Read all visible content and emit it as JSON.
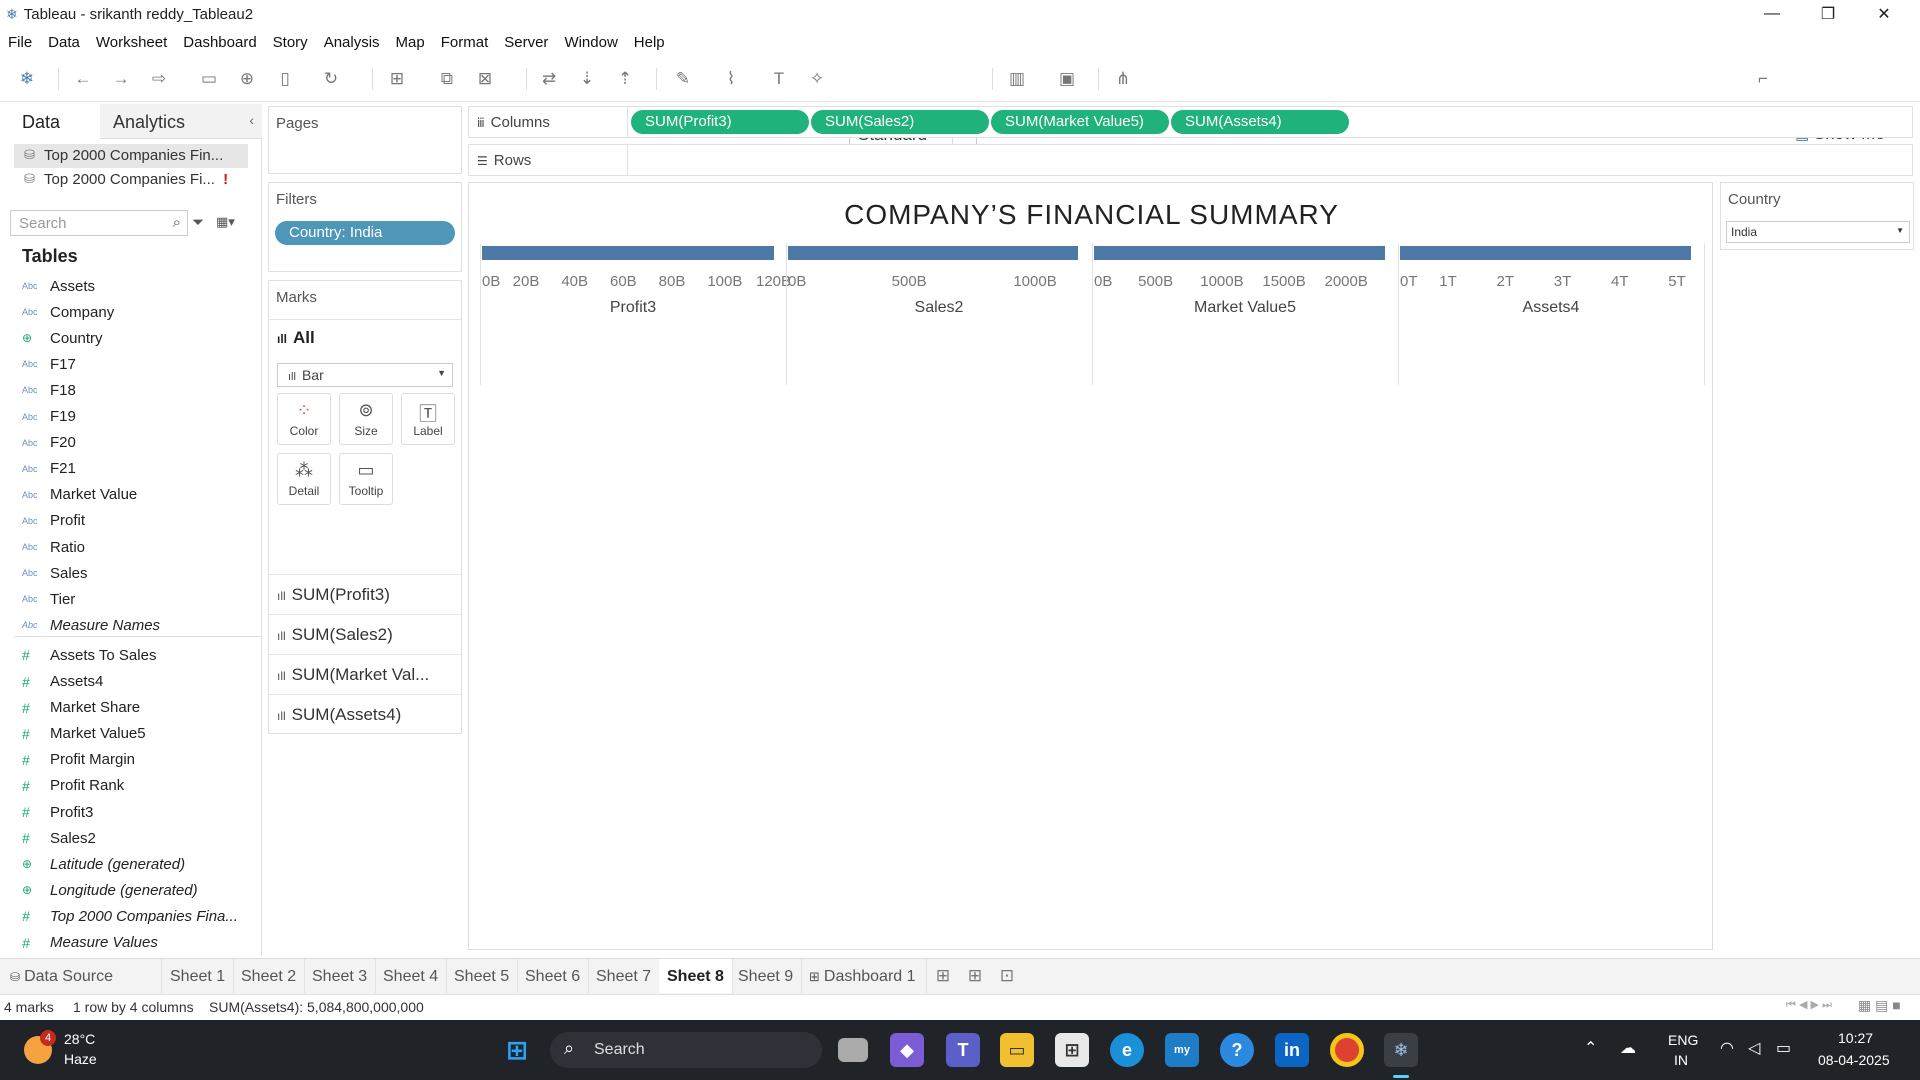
{
  "window": {
    "title": "Tableau - srikanth reddy_Tableau2"
  },
  "menu": [
    "File",
    "Data",
    "Worksheet",
    "Dashboard",
    "Story",
    "Analysis",
    "Map",
    "Format",
    "Server",
    "Window",
    "Help"
  ],
  "toolbar": {
    "fit": "Standard",
    "show_me": "Show Me"
  },
  "data_pane": {
    "tab_data": "Data",
    "tab_analytics": "Analytics",
    "sources": [
      "Top 2000 Companies Fin...",
      "Top 2000 Companies Fi..."
    ],
    "source_warning": "!",
    "search_placeholder": "Search",
    "tables_label": "Tables",
    "dimensions": [
      {
        "name": "Assets",
        "type": "Abc"
      },
      {
        "name": "Company",
        "type": "Abc"
      },
      {
        "name": "Country",
        "type": "geo"
      },
      {
        "name": "F17",
        "type": "Abc"
      },
      {
        "name": "F18",
        "type": "Abc"
      },
      {
        "name": "F19",
        "type": "Abc"
      },
      {
        "name": "F20",
        "type": "Abc"
      },
      {
        "name": "F21",
        "type": "Abc"
      },
      {
        "name": "Market Value",
        "type": "Abc"
      },
      {
        "name": "Profit",
        "type": "Abc"
      },
      {
        "name": "Ratio",
        "type": "Abc"
      },
      {
        "name": "Sales",
        "type": "Abc"
      },
      {
        "name": "Tier",
        "type": "Abc"
      },
      {
        "name": "Measure Names",
        "type": "Abc"
      }
    ],
    "measures": [
      {
        "name": "Assets To Sales",
        "type": "#"
      },
      {
        "name": "Assets4",
        "type": "#"
      },
      {
        "name": "Market Share",
        "type": "#"
      },
      {
        "name": "Market Value5",
        "type": "#"
      },
      {
        "name": "Profit Margin",
        "type": "#"
      },
      {
        "name": "Profit Rank",
        "type": "#"
      },
      {
        "name": "Profit3",
        "type": "#"
      },
      {
        "name": "Sales2",
        "type": "#"
      },
      {
        "name": "Latitude (generated)",
        "type": "geo"
      },
      {
        "name": "Longitude (generated)",
        "type": "geo"
      },
      {
        "name": "Top 2000 Companies Fina...",
        "type": "#"
      },
      {
        "name": "Measure Values",
        "type": "#"
      }
    ]
  },
  "shelves": {
    "pages": "Pages",
    "filters": "Filters",
    "filter_pill": "Country: India",
    "marks": "Marks",
    "marks_all": "All",
    "mark_type": "Bar",
    "mark_buttons": [
      "Color",
      "Size",
      "Label",
      "Detail",
      "Tooltip"
    ],
    "mark_measures": [
      "SUM(Profit3)",
      "SUM(Sales2)",
      "SUM(Market Val...",
      "SUM(Assets4)"
    ],
    "columns": "Columns",
    "rows": "Rows",
    "column_pills": [
      "SUM(Profit3)",
      "SUM(Sales2)",
      "SUM(Market Value5)",
      "SUM(Assets4)"
    ]
  },
  "country_filter": {
    "title": "Country",
    "value": "India"
  },
  "chart_data": {
    "type": "bar",
    "title": "COMPANY’S FINANCIAL SUMMARY",
    "panes": [
      {
        "name": "Profit3",
        "ticks": [
          "0B",
          "20B",
          "40B",
          "60B",
          "80B",
          "100B",
          "120B"
        ],
        "xlim": [
          0,
          120
        ],
        "value": 121,
        "unit": "B"
      },
      {
        "name": "Sales2",
        "ticks": [
          "0B",
          "500B",
          "1000B"
        ],
        "xlim": [
          0,
          1200
        ],
        "value": 1190,
        "unit": "B"
      },
      {
        "name": "Market Value5",
        "ticks": [
          "0B",
          "500B",
          "1000B",
          "1500B",
          "2000B"
        ],
        "xlim": [
          0,
          2350
        ],
        "value": 2340,
        "unit": "B"
      },
      {
        "name": "Assets4",
        "ticks": [
          "0T",
          "1T",
          "2T",
          "3T",
          "4T",
          "5T"
        ],
        "xlim": [
          0,
          5.1
        ],
        "value": 5.0848,
        "unit": "T"
      }
    ]
  },
  "sheet_tabs": [
    "Data Source",
    "Sheet 1",
    "Sheet 2",
    "Sheet 3",
    "Sheet 4",
    "Sheet 5",
    "Sheet 6",
    "Sheet 7",
    "Sheet 8",
    "Sheet 9",
    "Dashboard 1"
  ],
  "active_tab": "Sheet 8",
  "status": {
    "marks": "4 marks",
    "dims": "1 row by 4 columns",
    "sum": "SUM(Assets4): 5,084,800,000,000"
  },
  "taskbar": {
    "temp": "28°C",
    "weather": "Haze",
    "badge": "4",
    "search": "Search",
    "lang1": "ENG",
    "lang2": "IN",
    "time": "10:27",
    "date": "08-04-2025"
  }
}
